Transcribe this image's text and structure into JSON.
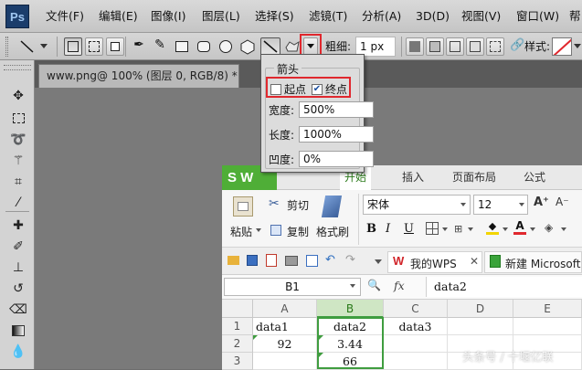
{
  "ps": {
    "logo": "Ps",
    "menu": [
      "文件(F)",
      "编辑(E)",
      "图像(I)",
      "图层(L)",
      "选择(S)",
      "滤镜(T)",
      "分析(A)",
      "3D(D)",
      "视图(V)",
      "窗口(W)",
      "帮"
    ],
    "options": {
      "weight_label": "粗细:",
      "weight_value": "1 px",
      "style_label": "样式:"
    },
    "document_tab": "www.png@ 100% (图层 0, RGB/8) *"
  },
  "arrow_popup": {
    "title": "箭头",
    "start_label": "起点",
    "start_checked": false,
    "end_label": "终点",
    "end_checked": true,
    "width_label": "宽度:",
    "width_value": "500%",
    "length_label": "长度:",
    "length_value": "1000%",
    "concavity_label": "凹度:",
    "concavity_value": "0%"
  },
  "wps": {
    "logo": "S W",
    "tabs": [
      "开始",
      "插入",
      "页面布局",
      "公式"
    ],
    "ribbon": {
      "paste": "粘贴",
      "cut": "剪切",
      "copy": "复制",
      "format_painter": "格式刷",
      "font_name": "宋体",
      "font_size": "12",
      "bold": "B",
      "italic": "I",
      "underline": "U"
    },
    "doc_tabs": [
      "我的WPS",
      "新建 Microsoft"
    ],
    "name_box": "B1",
    "fx": "fx",
    "formula": "data2",
    "columns": [
      "A",
      "B",
      "C",
      "D",
      "E"
    ],
    "rows": [
      "1",
      "2",
      "3"
    ],
    "cells": [
      [
        "data1",
        "data2",
        "data3",
        "",
        ""
      ],
      [
        "92",
        "3.44",
        "",
        "",
        ""
      ],
      [
        "",
        "66",
        "",
        "",
        ""
      ]
    ]
  },
  "watermark": "头条号 / 十堰亿联"
}
